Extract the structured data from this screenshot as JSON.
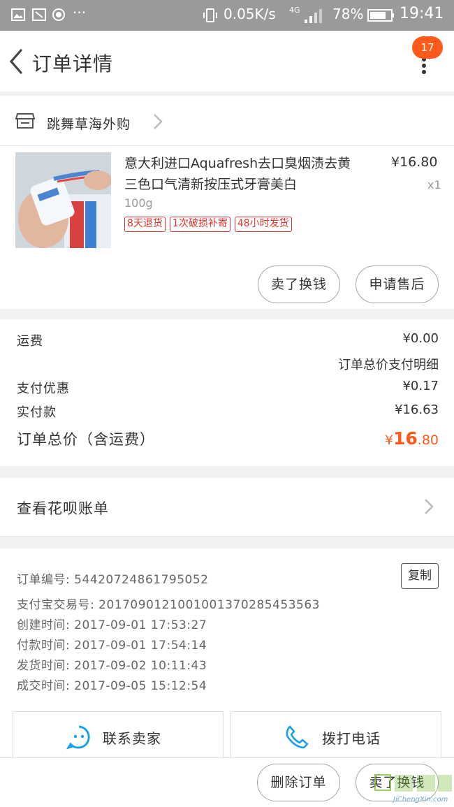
{
  "status_bar": {
    "speed": "0.05K/s",
    "network": "4G",
    "battery": "78%",
    "time": "19:41"
  },
  "header": {
    "title": "订单详情",
    "badge_count": "17"
  },
  "store": {
    "name": "跳舞草海外购"
  },
  "product": {
    "name": "意大利进口Aquafresh去口臭烟渍去黄三色口气清新按压式牙膏美白",
    "spec": "100g",
    "price": "¥16.80",
    "qty": "x1",
    "tags": [
      "8天退货",
      "1次破损补寄",
      "48小时发货"
    ],
    "sell_button": "卖了换钱",
    "aftersale_button": "申请售后"
  },
  "summary": {
    "shipping_label": "运费",
    "shipping_value": "¥0.00",
    "detail_link": "订单总价支付明细",
    "discount_label": "支付优惠",
    "discount_value": "¥0.17",
    "paid_label": "实付款",
    "paid_value": "¥16.63",
    "total_label": "订单总价（含运费）",
    "total_currency": "¥",
    "total_int": "16",
    "total_dec": ".80"
  },
  "huabei": {
    "label": "查看花呗账单"
  },
  "order_info": {
    "order_no": "订单编号: 54420724861795052",
    "alipay_no": "支付宝交易号: 2017090121001001370285453563",
    "created": "创建时间: 2017-09-01 17:53:27",
    "paid": "付款时间: 2017-09-01 17:54:14",
    "shipped": "发货时间: 2017-09-02 10:11:43",
    "completed": "成交时间: 2017-09-05 15:12:54",
    "copy_button": "复制"
  },
  "contact": {
    "seller": "联系卖家",
    "call": "拨打电话"
  },
  "bottom_bar": {
    "delete": "删除订单",
    "sell": "卖了换钱"
  },
  "watermark": {
    "site": "JiChengXin.com"
  },
  "colors": {
    "accent": "#ff5a1a",
    "tag_red": "#e2332c",
    "icon_blue": "#1aa0e6"
  }
}
